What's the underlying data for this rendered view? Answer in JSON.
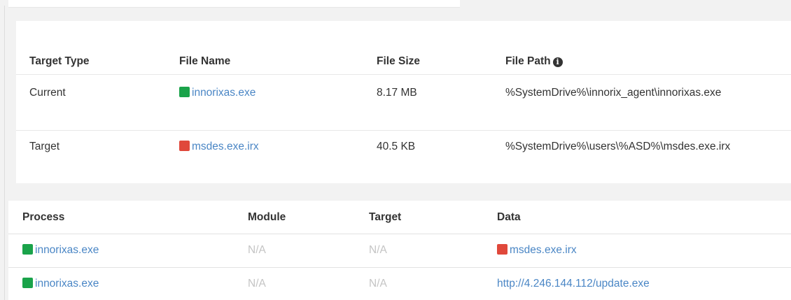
{
  "colors": {
    "link": "#4a86c5",
    "status_green": "#1aa34a",
    "status_red": "#e0483b",
    "na_text": "#c4c4c4"
  },
  "target_table": {
    "headers": {
      "target_type": "Target Type",
      "file_name": "File Name",
      "file_size": "File Size",
      "file_path": "File Path"
    },
    "rows": [
      {
        "target_type": "Current",
        "file_name": "innorixas.exe",
        "status": "green",
        "file_size": "8.17 MB",
        "file_path": "%SystemDrive%\\innorix_agent\\innorixas.exe"
      },
      {
        "target_type": "Target",
        "file_name": "msdes.exe.irx",
        "status": "red",
        "file_size": "40.5 KB",
        "file_path": "%SystemDrive%\\users\\%ASD%\\msdes.exe.irx"
      }
    ]
  },
  "process_table": {
    "headers": {
      "process": "Process",
      "module": "Module",
      "target": "Target",
      "data": "Data"
    },
    "rows": [
      {
        "process": "innorixas.exe",
        "process_status": "green",
        "module": "N/A",
        "target": "N/A",
        "data": "msdes.exe.irx",
        "data_status": "red"
      },
      {
        "process": "innorixas.exe",
        "process_status": "green",
        "module": "N/A",
        "target": "N/A",
        "data": "http://4.246.144.112/update.exe"
      }
    ]
  }
}
